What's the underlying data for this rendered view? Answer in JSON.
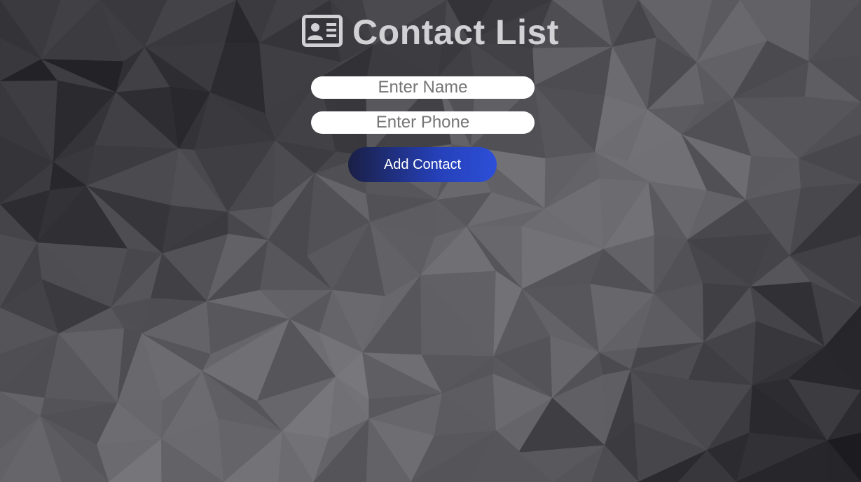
{
  "page": {
    "title": "Contact List",
    "title_icon": "address-card-icon"
  },
  "form": {
    "name_placeholder": "Enter Name",
    "name_value": "",
    "phone_placeholder": "Enter Phone",
    "phone_value": "",
    "add_button_label": "Add Contact"
  },
  "colors": {
    "title_text": "#d2d2d4",
    "button_gradient_start": "#1a1f45",
    "button_gradient_end": "#2d4fd8",
    "background": "#3a3a3f"
  }
}
